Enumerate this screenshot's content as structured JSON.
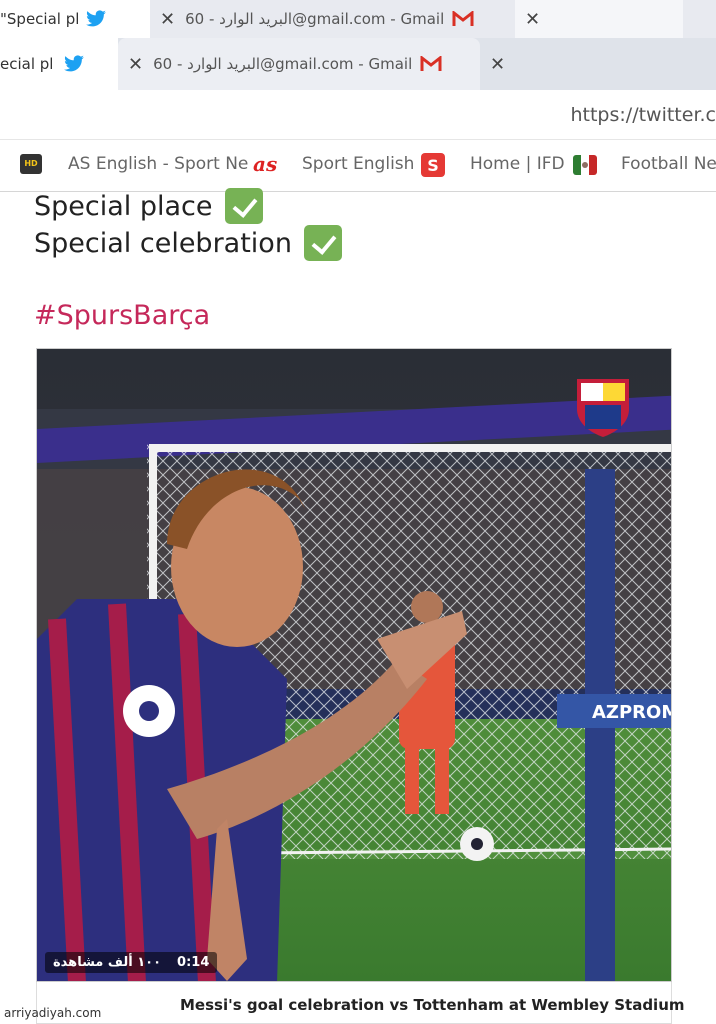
{
  "tabs_back": [
    {
      "label": "\"Special pl",
      "icon": "twitter-bird-icon"
    },
    {
      "label": "البريد الوارد - 60@gmail.com - Gmail",
      "icon": "gmail-icon"
    },
    {
      "label": ""
    }
  ],
  "tabs_front": [
    {
      "label": "ecial pl",
      "icon": "twitter-bird-icon"
    },
    {
      "label": "البريد الوارد - 60@gmail.com - Gmail",
      "icon": "gmail-icon"
    },
    {
      "label": ""
    }
  ],
  "close_glyph": "✕",
  "address_bar": {
    "url": "https://twitter.c"
  },
  "bookmarks": [
    {
      "label": "AS English - Sport Ne",
      "icon": "hd-icon"
    },
    {
      "label": "Sport English",
      "icon": "as-logo-icon",
      "logo_text": "as"
    },
    {
      "label": "Home | IFD",
      "icon": "s-logo-icon",
      "logo_text": "S"
    },
    {
      "label": "Football Ne",
      "icon": "mexico-flag-icon"
    }
  ],
  "tweet": {
    "line1": "Special place",
    "line2": "Special celebration",
    "hashtag": "#SpursBarça"
  },
  "video": {
    "duration": "0:14",
    "views": "١٠٠ ألف مشاهدة",
    "board_text": "AZPROM",
    "caption": "Messi's goal celebration vs Tottenham at Wembley Stadium"
  },
  "watermark": "arriyadiyah.com",
  "colors": {
    "hashtag": "#c5285a",
    "check_green": "#77b255",
    "twitter_blue": "#1da1f2",
    "gmail_red": "#d93025"
  }
}
